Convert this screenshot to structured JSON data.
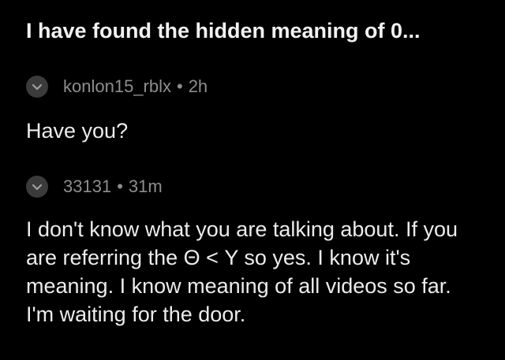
{
  "post": {
    "title": "I have found the hidden meaning of 0..."
  },
  "comments": [
    {
      "username": "konlon15_rblx",
      "separator": "•",
      "time": "2h",
      "body": "Have you?",
      "collapse_icon": "chevron-down-icon"
    },
    {
      "username": "33131",
      "separator": "•",
      "time": "31m",
      "body": "I don't know what you are talking about. If you are referring the Θ < Y so yes. I know it's meaning. I know meaning of all videos so far. I'm waiting for the door.",
      "collapse_icon": "chevron-down-icon"
    }
  ],
  "colors": {
    "background": "#000000",
    "title": "#f2f2f2",
    "meta": "#8e8e8e",
    "body": "#ececec",
    "icon_circle": "#3b3b3b"
  }
}
